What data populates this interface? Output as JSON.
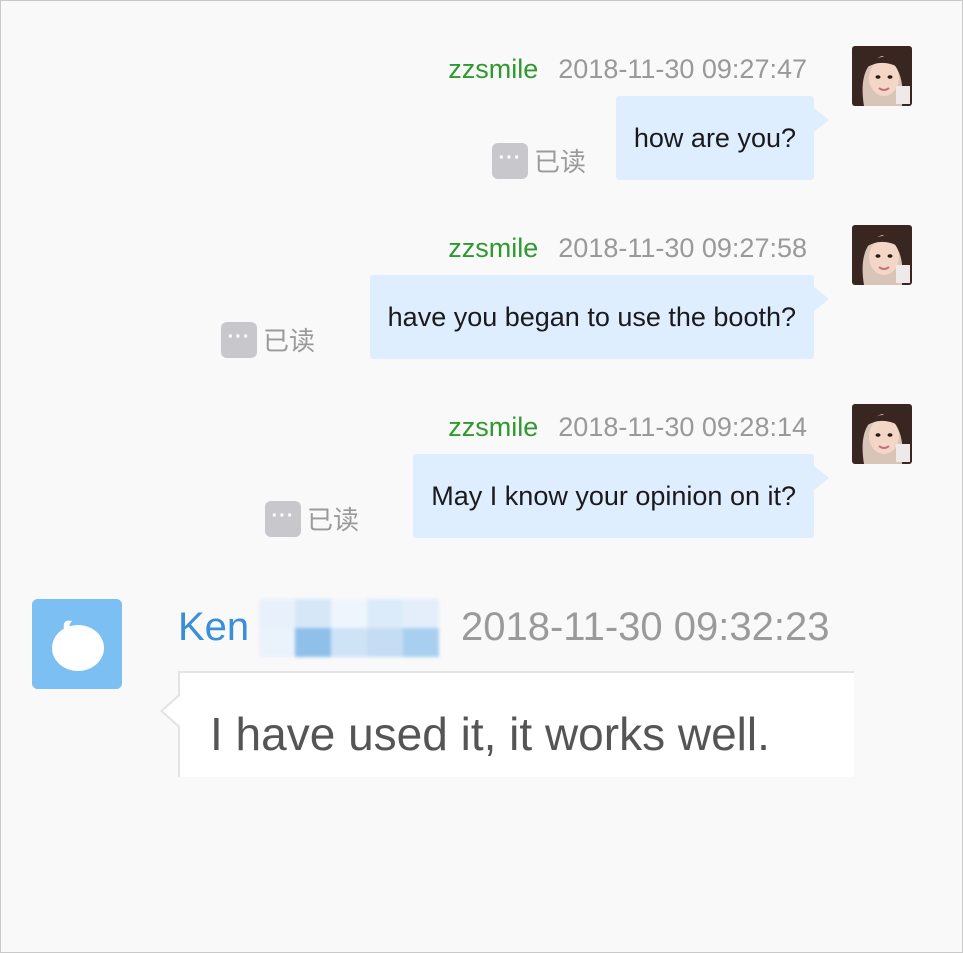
{
  "outgoing_messages": [
    {
      "sender": "zzsmile",
      "timestamp": "2018-11-30 09:27:47",
      "text": "how are you?",
      "receipt_icon": "ellipsis-icon",
      "receipt": "已读"
    },
    {
      "sender": "zzsmile",
      "timestamp": "2018-11-30 09:27:58",
      "text": "have you began to use the booth?",
      "receipt_icon": "ellipsis-icon",
      "receipt": "已读"
    },
    {
      "sender": "zzsmile",
      "timestamp": "2018-11-30 09:28:14",
      "text": "May I know your opinion on it?",
      "receipt_icon": "ellipsis-icon",
      "receipt": "已读"
    }
  ],
  "incoming_message": {
    "sender_visible": "Ken",
    "sender_rest_redacted": true,
    "timestamp": "2018-11-30 09:32:23",
    "text": "I have used it, it works well.",
    "avatar_icon": "speech-bubble-icon"
  },
  "receipt_dots": "···",
  "colors": {
    "sender_green": "#2e9a2e",
    "timestamp_gray": "#999999",
    "outgoing_bubble": "#deeeff",
    "incoming_name_blue": "#3a8fd9",
    "incoming_avatar": "#7cbff3",
    "receipt_badge": "#c7c7cc"
  }
}
